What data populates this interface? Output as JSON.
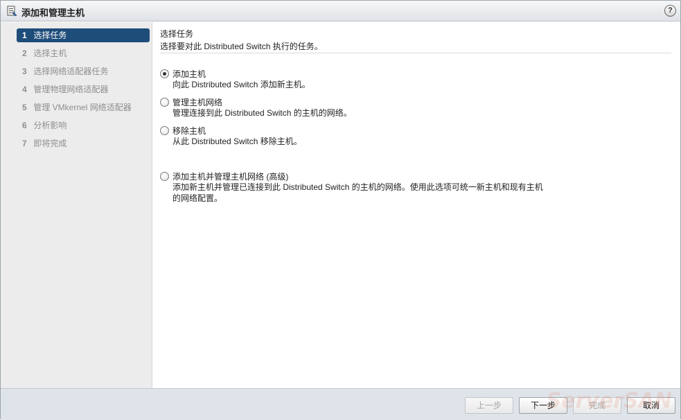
{
  "window": {
    "title": "添加和管理主机",
    "help_label": "?"
  },
  "sidebar": {
    "steps": [
      {
        "num": "1",
        "label": "选择任务",
        "active": true
      },
      {
        "num": "2",
        "label": "选择主机",
        "active": false
      },
      {
        "num": "3",
        "label": "选择网络适配器任务",
        "active": false
      },
      {
        "num": "4",
        "label": "管理物理网络适配器",
        "active": false
      },
      {
        "num": "5",
        "label": "管理 VMkernel 网络适配器",
        "active": false
      },
      {
        "num": "6",
        "label": "分析影响",
        "active": false
      },
      {
        "num": "7",
        "label": "即将完成",
        "active": false
      }
    ]
  },
  "main": {
    "heading": "选择任务",
    "subheading": "选择要对此 Distributed Switch 执行的任务。",
    "options": [
      {
        "label": "添加主机",
        "description": "向此 Distributed Switch 添加新主机。",
        "selected": true
      },
      {
        "label": "管理主机网络",
        "description": "管理连接到此 Distributed Switch 的主机的网络。",
        "selected": false
      },
      {
        "label": "移除主机",
        "description": "从此 Distributed Switch 移除主机。",
        "selected": false
      },
      {
        "label": "添加主机并管理主机网络 (高级)",
        "description": "添加新主机并管理已连接到此 Distributed Switch 的主机的网络。使用此选项可统一新主机和现有主机的网络配置。",
        "selected": false
      }
    ]
  },
  "footer": {
    "back_label": "上一步",
    "next_label": "下一步",
    "finish_label": "完成",
    "cancel_label": "取消"
  },
  "watermark": "ServerSAN"
}
